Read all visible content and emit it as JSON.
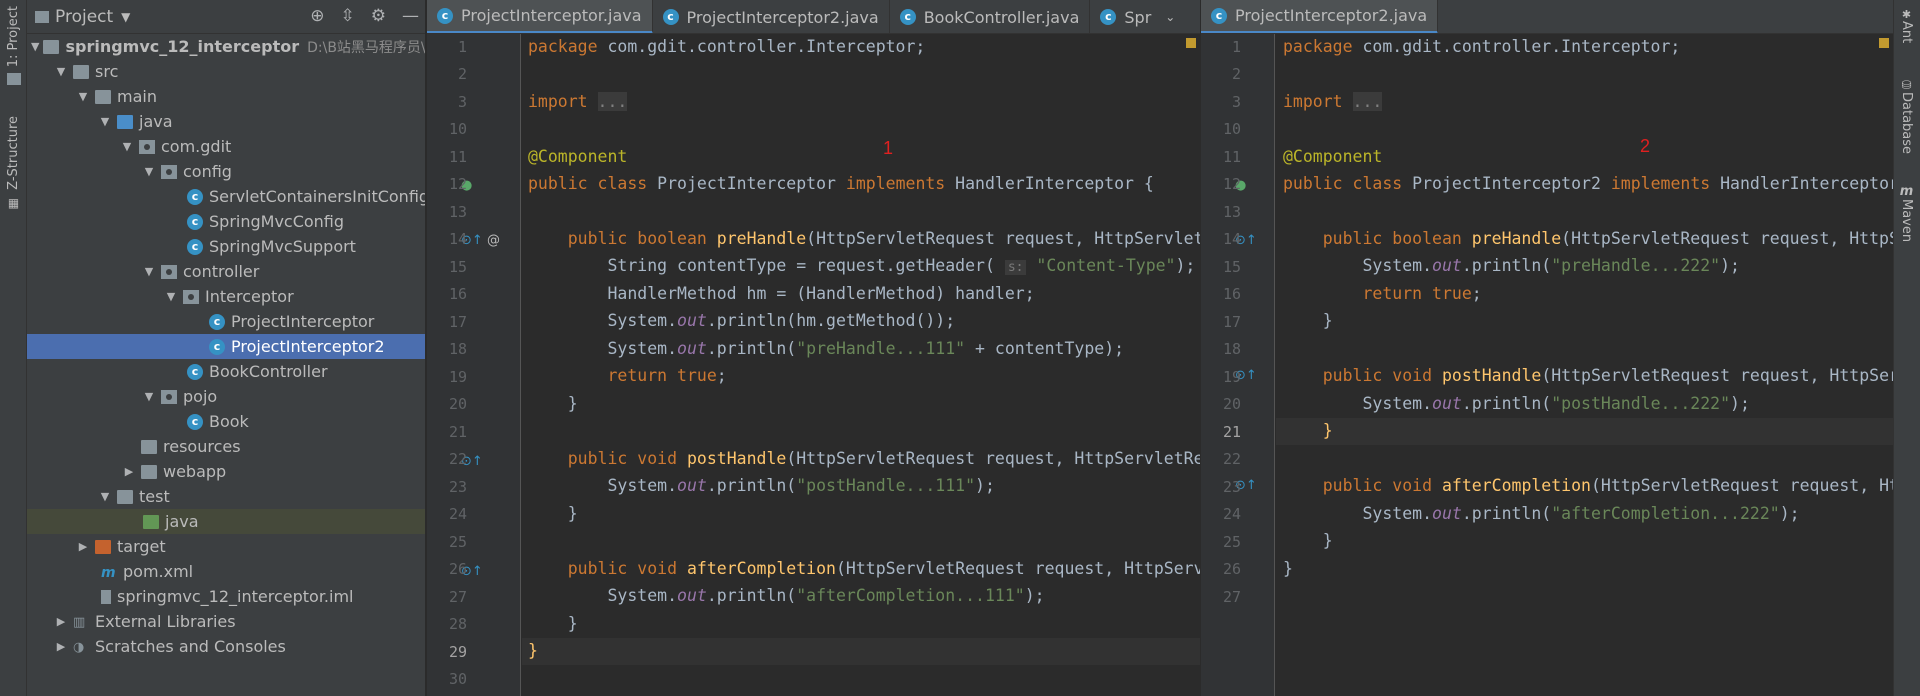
{
  "left_strip": {
    "project_tab": "1: Project",
    "structure_tab": "Z-Structure"
  },
  "right_strip": {
    "ant_tab": "Ant",
    "database_tab": "Database",
    "maven_tab": "Maven"
  },
  "project_panel": {
    "title": "Project",
    "tree": [
      {
        "label": "springmvc_12_interceptor",
        "path": "D:\\B站黑马程序员\\SSM"
      },
      {
        "label": "src"
      },
      {
        "label": "main"
      },
      {
        "label": "java"
      },
      {
        "label": "com.gdit"
      },
      {
        "label": "config"
      },
      {
        "label": "ServletContainersInitConfig"
      },
      {
        "label": "SpringMvcConfig"
      },
      {
        "label": "SpringMvcSupport"
      },
      {
        "label": "controller"
      },
      {
        "label": "Interceptor"
      },
      {
        "label": "ProjectInterceptor"
      },
      {
        "label": "ProjectInterceptor2"
      },
      {
        "label": "BookController"
      },
      {
        "label": "pojo"
      },
      {
        "label": "Book"
      },
      {
        "label": "resources"
      },
      {
        "label": "webapp"
      },
      {
        "label": "test"
      },
      {
        "label": "java"
      },
      {
        "label": "target"
      },
      {
        "label": "pom.xml"
      },
      {
        "label": "springmvc_12_interceptor.iml"
      },
      {
        "label": "External Libraries"
      },
      {
        "label": "Scratches and Consoles"
      }
    ]
  },
  "left_editor": {
    "tabs": [
      "ProjectInterceptor.java",
      "ProjectInterceptor2.java",
      "BookController.java",
      "Spr"
    ],
    "annotation_mark": "1",
    "line_numbers": [
      "1",
      "2",
      "3",
      "10",
      "11",
      "12",
      "13",
      "14",
      "15",
      "16",
      "17",
      "18",
      "19",
      "20",
      "21",
      "22",
      "23",
      "24",
      "25",
      "26",
      "27",
      "28",
      "29",
      "30"
    ],
    "param_hint": "s:"
  },
  "right_editor": {
    "tabs": [
      "ProjectInterceptor2.java"
    ],
    "annotation_mark": "2",
    "line_numbers": [
      "1",
      "2",
      "3",
      "10",
      "11",
      "12",
      "13",
      "14",
      "15",
      "16",
      "17",
      "18",
      "19",
      "20",
      "21",
      "22",
      "23",
      "24",
      "25",
      "26",
      "27"
    ]
  },
  "colors": {
    "keyword": "#cc7832",
    "annotation": "#bbb529",
    "string": "#6a8759",
    "method": "#ffc66d",
    "static_field": "#9876aa",
    "selection": "#4b6eaf"
  }
}
